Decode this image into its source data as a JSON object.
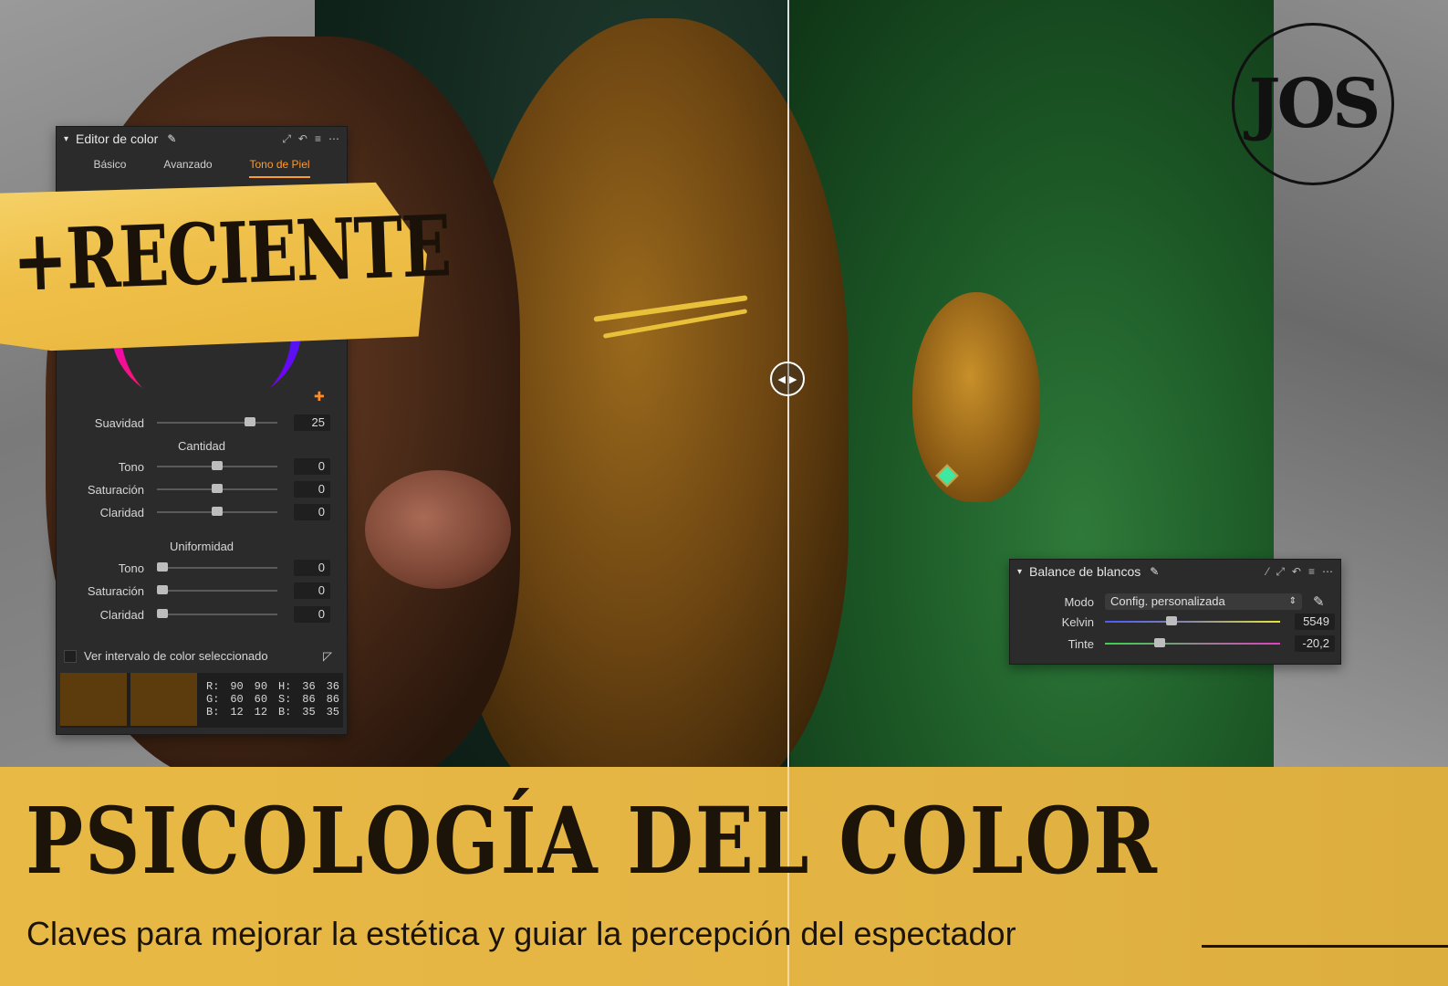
{
  "color_editor": {
    "title": "Editor de color",
    "tabs": [
      "Básico",
      "Avanzado",
      "Tono de Piel"
    ],
    "active_tab": "Tono de Piel",
    "suavidad": {
      "label": "Suavidad",
      "value": "25",
      "level": 0.8
    },
    "cantidad": {
      "heading": "Cantidad",
      "rows": [
        {
          "label": "Tono",
          "value": "0",
          "level": 0.5
        },
        {
          "label": "Saturación",
          "value": "0",
          "level": 0.5
        },
        {
          "label": "Claridad",
          "value": "0",
          "level": 0.5
        }
      ]
    },
    "uniformidad": {
      "heading": "Uniformidad",
      "rows": [
        {
          "label": "Tono",
          "value": "0",
          "level": 0.0
        },
        {
          "label": "Saturación",
          "value": "0",
          "level": 0.0
        },
        {
          "label": "Claridad",
          "value": "0",
          "level": 0.0
        }
      ]
    },
    "show_range_label": "Ver intervalo de color seleccionado",
    "swatch_color": "#5c3c0c",
    "rgb_readout": [
      [
        "R:",
        "90",
        "90",
        "H:",
        "36",
        "36"
      ],
      [
        "G:",
        "60",
        "60",
        "S:",
        "86",
        "86"
      ],
      [
        "B:",
        "12",
        "12",
        "B:",
        "35",
        "35"
      ]
    ]
  },
  "white_balance": {
    "title": "Balance de blancos",
    "mode_label": "Modo",
    "mode_value": "Config. personalizada",
    "kelvin": {
      "label": "Kelvin",
      "value": "5549",
      "level": 0.37
    },
    "tint": {
      "label": "Tinte",
      "value": "-20,2",
      "level": 0.3
    }
  },
  "tape_label": "+RECIENTE",
  "logo_text": "JOS",
  "banner": {
    "title": "PSICOLOGÍA DEL  COLOR",
    "subtitle": "Claves para mejorar la estética y guiar la percepción del espectador"
  },
  "colors": {
    "accent_orange": "#ff9a2e",
    "banner_yellow": "#e6b643",
    "text_dark": "#1c1409"
  },
  "icons": [
    "chevron-down-icon",
    "eyedropper-icon",
    "expand-icon",
    "undo-icon",
    "menu-icon",
    "more-icon",
    "split-handle-icon",
    "cursor-icon"
  ]
}
